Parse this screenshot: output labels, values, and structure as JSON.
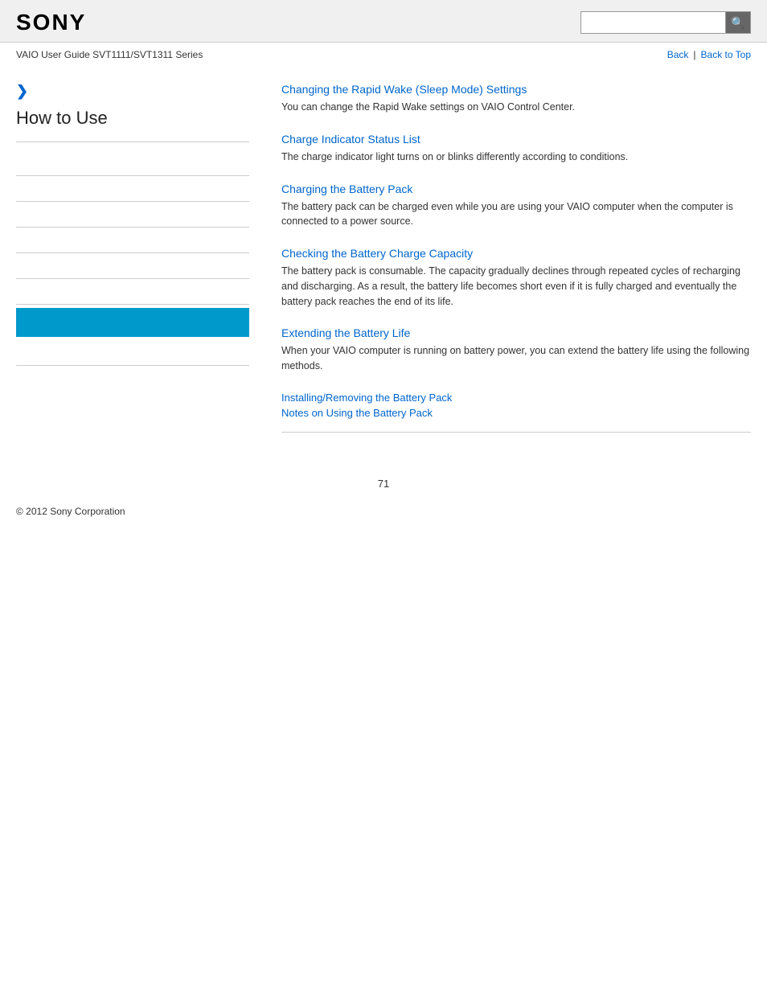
{
  "header": {
    "logo": "SONY",
    "search_placeholder": "",
    "search_icon": "🔍"
  },
  "subheader": {
    "title": "VAIO User Guide SVT1111/SVT1311 Series",
    "nav": {
      "back_label": "Back",
      "separator": "|",
      "back_to_top_label": "Back to Top"
    }
  },
  "sidebar": {
    "chevron": "❯",
    "title": "How to Use",
    "items": [
      {
        "label": ""
      },
      {
        "label": ""
      },
      {
        "label": ""
      },
      {
        "label": ""
      },
      {
        "label": ""
      },
      {
        "label": ""
      },
      {
        "label": "highlighted"
      },
      {
        "label": ""
      }
    ]
  },
  "content": {
    "sections": [
      {
        "id": "rapid-wake",
        "link_text": "Changing the Rapid Wake (Sleep Mode) Settings",
        "description": "You can change the Rapid Wake settings on VAIO Control Center."
      },
      {
        "id": "charge-indicator",
        "link_text": "Charge Indicator Status List",
        "description": "The charge indicator light turns on or blinks differently according to conditions."
      },
      {
        "id": "charging-battery",
        "link_text": "Charging the Battery Pack",
        "description": "The battery pack can be charged even while you are using your VAIO computer when the computer is connected to a power source."
      },
      {
        "id": "checking-capacity",
        "link_text": "Checking the Battery Charge Capacity",
        "description": "The battery pack is consumable. The capacity gradually declines through repeated cycles of recharging and discharging. As a result, the battery life becomes short even if it is fully charged and eventually the battery pack reaches the end of its life."
      },
      {
        "id": "extending-life",
        "link_text": "Extending the Battery Life",
        "description": "When your VAIO computer is running on battery power, you can extend the battery life using the following methods."
      }
    ],
    "plain_links": [
      {
        "id": "installing-removing",
        "text": "Installing/Removing the Battery Pack"
      },
      {
        "id": "notes-using",
        "text": "Notes on Using the Battery Pack"
      }
    ]
  },
  "footer": {
    "copyright": "© 2012 Sony Corporation"
  },
  "page_number": "71"
}
